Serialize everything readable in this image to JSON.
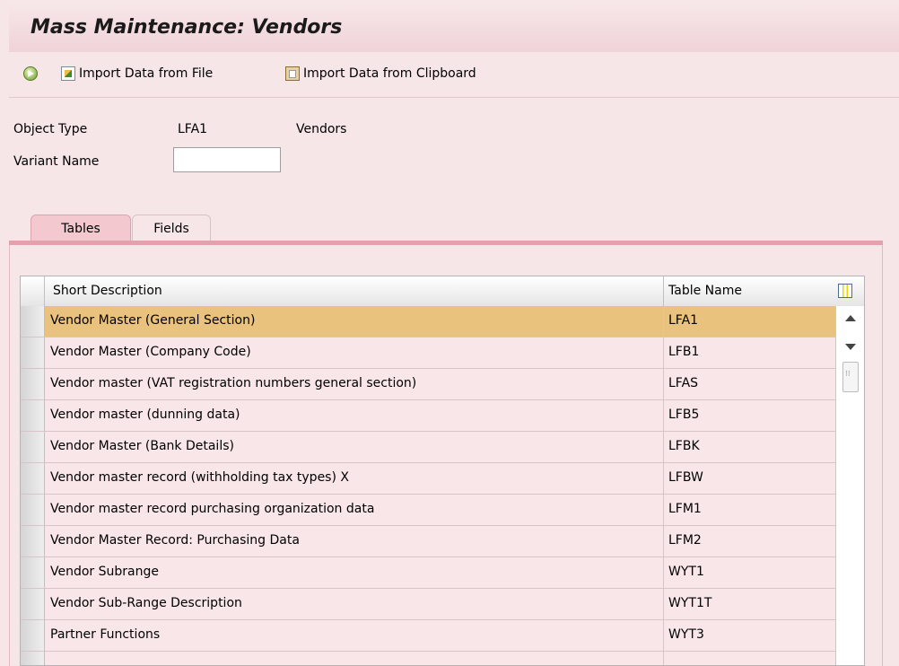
{
  "window": {
    "title": "Mass Maintenance: Vendors"
  },
  "toolbar": {
    "execute_icon": "execute-icon",
    "import_file_label": "Import Data from File",
    "import_clipboard_label": "Import Data from Clipboard"
  },
  "form": {
    "object_type_label": "Object Type",
    "object_type_value": "LFA1",
    "object_type_desc": "Vendors",
    "variant_name_label": "Variant Name",
    "variant_name_value": ""
  },
  "tabs": [
    {
      "label": "Tables",
      "active": true
    },
    {
      "label": "Fields",
      "active": false
    }
  ],
  "table": {
    "columns": [
      "Short Description",
      "Table Name"
    ],
    "rows": [
      {
        "desc": "Vendor Master (General Section)",
        "name": "LFA1",
        "selected": true
      },
      {
        "desc": "Vendor Master (Company Code)",
        "name": "LFB1"
      },
      {
        "desc": "Vendor master (VAT registration numbers general section)",
        "name": "LFAS"
      },
      {
        "desc": "Vendor master (dunning data)",
        "name": "LFB5"
      },
      {
        "desc": "Vendor Master (Bank Details)",
        "name": "LFBK"
      },
      {
        "desc": "Vendor master record (withholding tax types) X",
        "name": "LFBW"
      },
      {
        "desc": "Vendor master record purchasing organization data",
        "name": "LFM1"
      },
      {
        "desc": "Vendor Master Record: Purchasing Data",
        "name": "LFM2"
      },
      {
        "desc": "Vendor Subrange",
        "name": "WYT1"
      },
      {
        "desc": "Vendor Sub-Range Description",
        "name": "WYT1T"
      },
      {
        "desc": "Partner Functions",
        "name": "WYT3"
      },
      {
        "desc": "",
        "name": ""
      }
    ]
  }
}
